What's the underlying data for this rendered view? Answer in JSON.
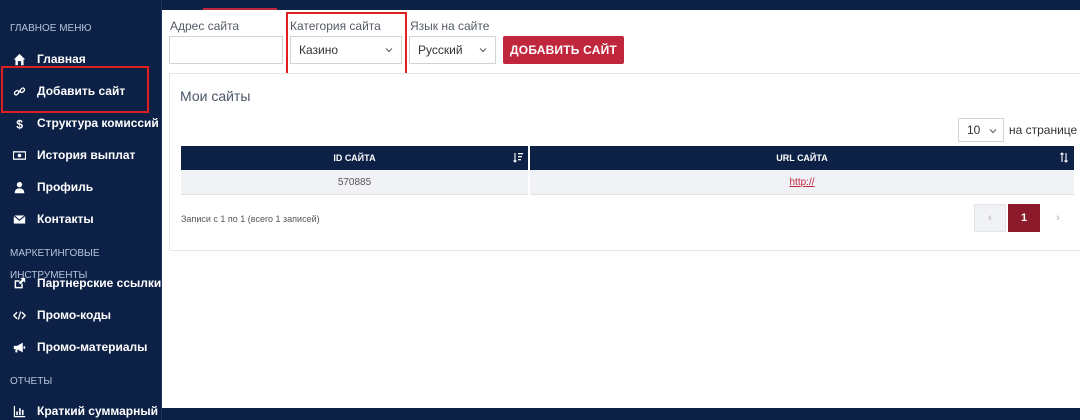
{
  "sidebar": {
    "section_main": "ГЛАВНОЕ МЕНЮ",
    "items_main": [
      {
        "label": "Главная",
        "icon": "home-icon"
      },
      {
        "label": "Добавить сайт",
        "icon": "link-icon"
      },
      {
        "label": "Структура комиссий",
        "icon": "dollar-icon"
      },
      {
        "label": "История выплат",
        "icon": "money-icon"
      },
      {
        "label": "Профиль",
        "icon": "user-icon"
      },
      {
        "label": "Контакты",
        "icon": "envelope-icon"
      }
    ],
    "section_marketing": "МАРКЕТИНГОВЫЕ ИНСТРУМЕНТЫ",
    "items_marketing": [
      {
        "label": "Партнерские ссылки",
        "icon": "external-link-icon"
      },
      {
        "label": "Промо-коды",
        "icon": "code-icon"
      },
      {
        "label": "Промо-материалы",
        "icon": "bullhorn-icon"
      }
    ],
    "section_reports": "ОТЧЕТЫ",
    "items_reports": [
      {
        "label": "Краткий суммарный",
        "icon": "bar-chart-icon"
      }
    ]
  },
  "form": {
    "site_address_label": "Адрес сайта",
    "site_address_value": "",
    "category_label": "Категория сайта",
    "category_value": "Казино",
    "language_label": "Язык на сайте",
    "language_value": "Русский",
    "add_button": "ДОБАВИТЬ САЙТ"
  },
  "my_sites": {
    "title": "Мои сайты",
    "per_page_value": "10",
    "per_page_label": "на странице",
    "columns": [
      "ID САЙТА",
      "URL САЙТА"
    ],
    "rows": [
      {
        "id": "570885",
        "url": "http://"
      }
    ],
    "records_info": "Записи с 1 по 1 (всего 1 записей)",
    "pagination": {
      "prev": "‹",
      "current": "1",
      "next": "›"
    }
  },
  "colors": {
    "sidebar_bg": "#0d2147",
    "accent": "#c0263c",
    "highlight_box": "#e02020"
  }
}
